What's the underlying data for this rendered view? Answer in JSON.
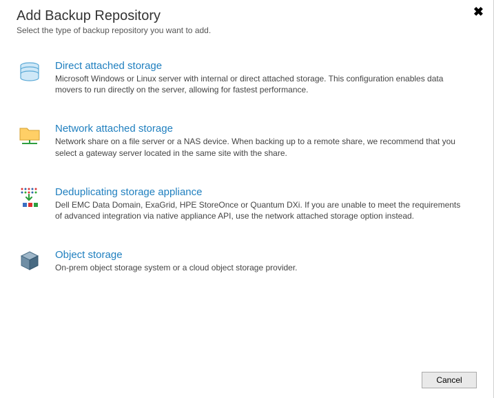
{
  "header": {
    "title": "Add Backup Repository",
    "subtitle": "Select the type of backup repository you want to add."
  },
  "options": [
    {
      "id": "direct-attached-storage",
      "title": "Direct attached storage",
      "description": "Microsoft Windows or Linux server with internal or direct attached storage. This configuration enables data movers to run directly on the server, allowing for fastest performance."
    },
    {
      "id": "network-attached-storage",
      "title": "Network attached storage",
      "description": "Network share on a file server or a NAS device. When backing up to a remote share, we recommend that you select a gateway server located in the same site with the share."
    },
    {
      "id": "deduplicating-storage-appliance",
      "title": "Deduplicating storage appliance",
      "description": "Dell EMC Data Domain, ExaGrid, HPE StoreOnce or Quantum DXi. If you are unable to meet the requirements of advanced integration via native appliance API, use the network attached storage option instead."
    },
    {
      "id": "object-storage",
      "title": "Object storage",
      "description": "On-prem object storage system or a cloud object storage provider."
    }
  ],
  "buttons": {
    "cancel": "Cancel"
  }
}
